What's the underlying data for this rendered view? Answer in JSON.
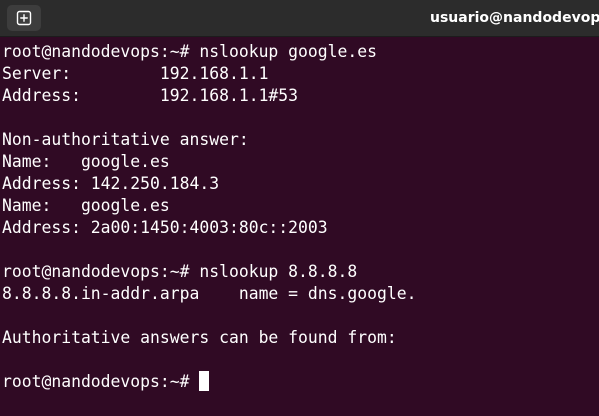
{
  "colors": {
    "terminal_background": "#300a24",
    "titlebar_background": "#2c2c2c",
    "text": "#ffffff"
  },
  "titlebar": {
    "new_tab_icon": "new-tab-icon",
    "title": "usuario@nandodevops: ~"
  },
  "terminal": {
    "lines": [
      "root@nandodevops:~# nslookup google.es",
      "Server:         192.168.1.1",
      "Address:        192.168.1.1#53",
      "",
      "Non-authoritative answer:",
      "Name:   google.es",
      "Address: 142.250.184.3",
      "Name:   google.es",
      "Address: 2a00:1450:4003:80c::2003",
      "",
      "root@nandodevops:~# nslookup 8.8.8.8",
      "8.8.8.8.in-addr.arpa    name = dns.google.",
      "",
      "Authoritative answers can be found from:",
      "",
      "root@nandodevops:~# "
    ]
  }
}
